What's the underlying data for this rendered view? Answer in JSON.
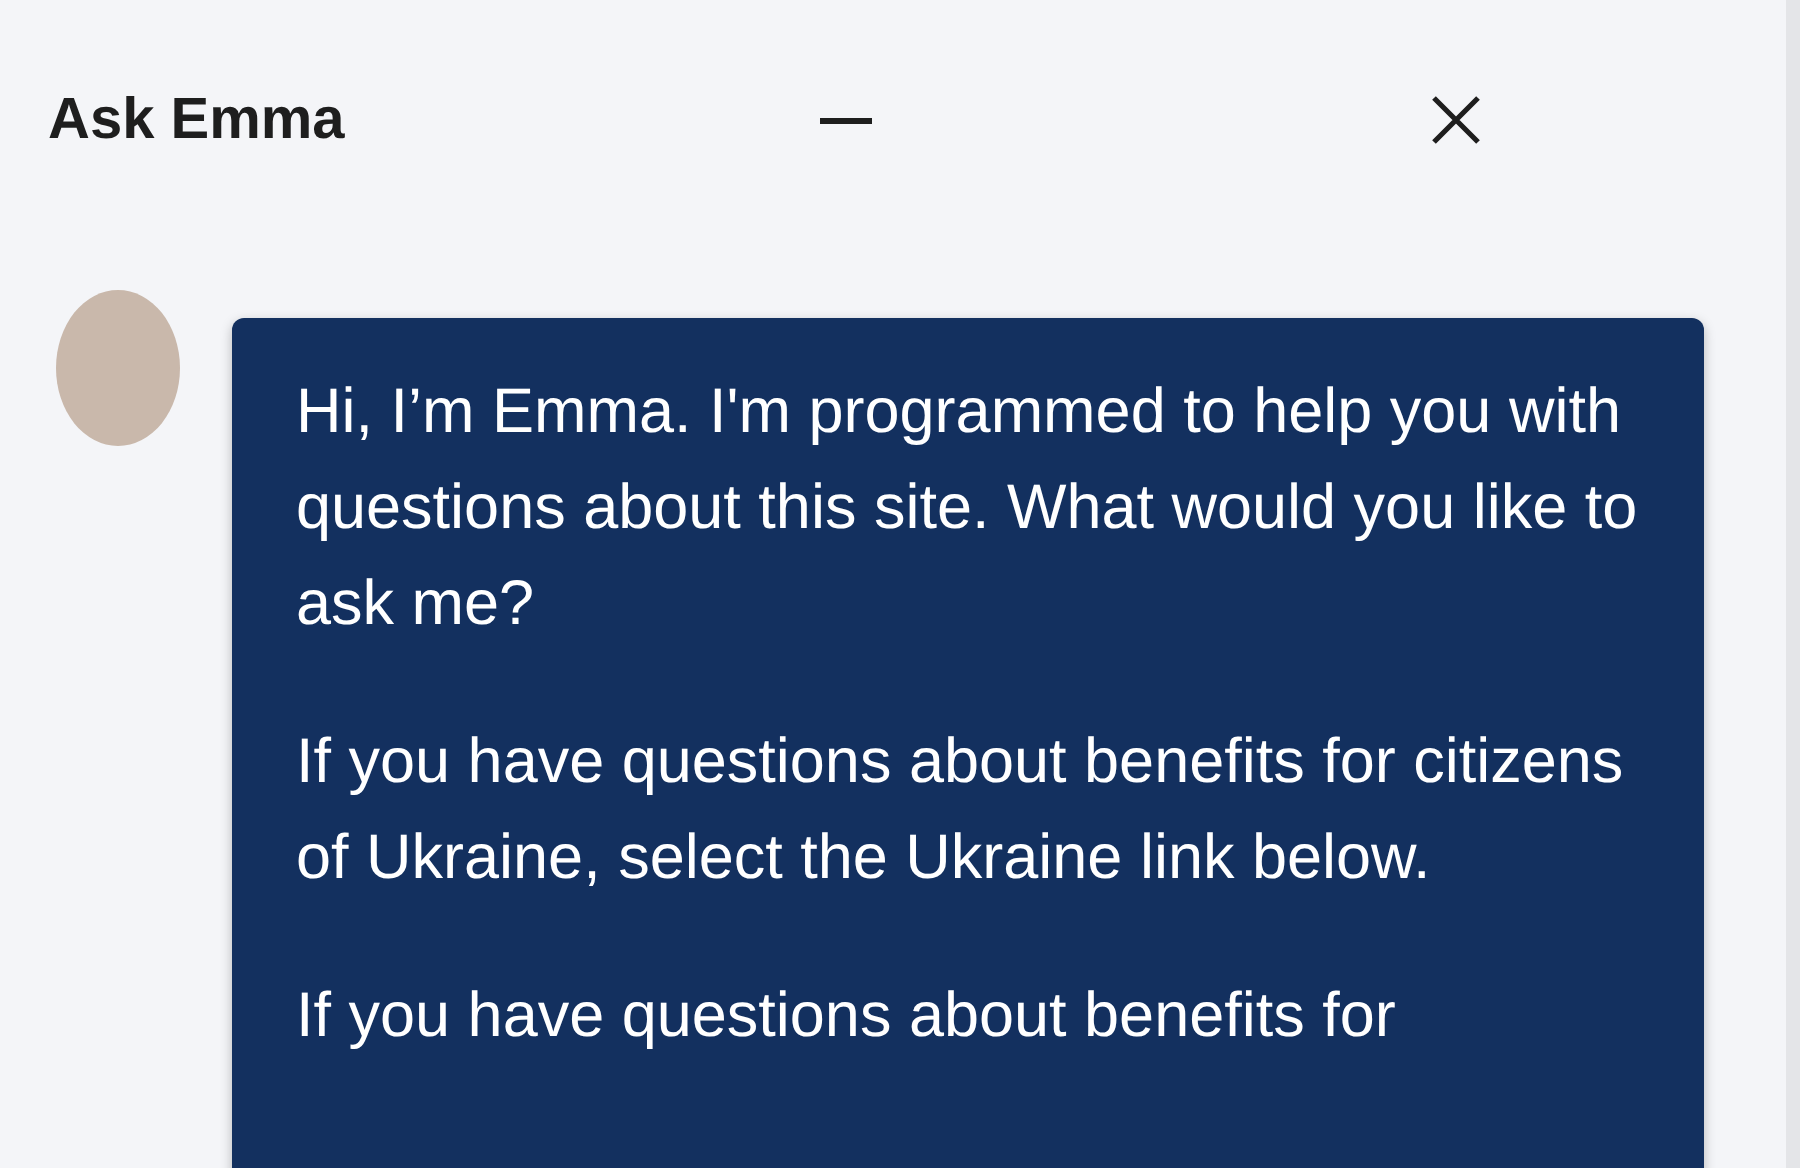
{
  "header": {
    "title": "Ask Emma"
  },
  "messages": [
    {
      "paragraphs": [
        "Hi, I’m Emma. I'm programmed to help you with questions about this site. What would you like to ask me?",
        "If you have questions about benefits for citizens of Ukraine, select the Ukraine link below.",
        "If you have questions about benefits for"
      ]
    }
  ]
}
